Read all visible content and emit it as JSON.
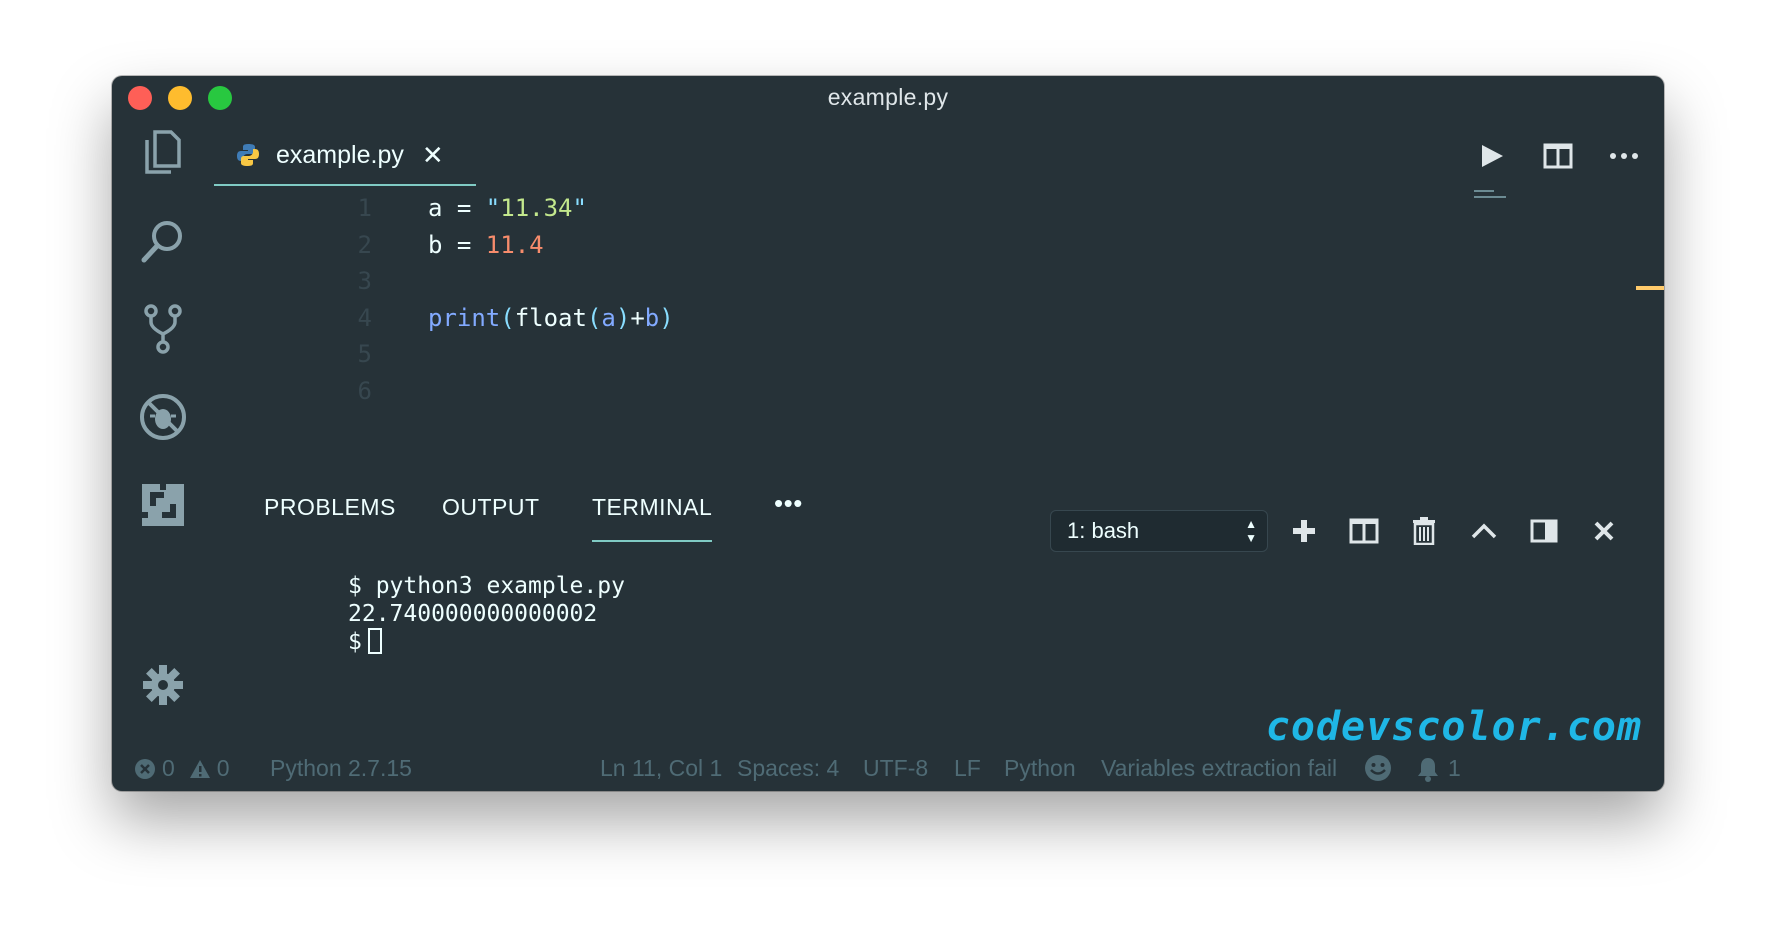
{
  "window": {
    "title": "example.py"
  },
  "tab": {
    "label": "example.py",
    "close": "✕"
  },
  "code_lines": [
    {
      "num": "1",
      "segments": [
        {
          "t": "a = ",
          "c": "plain"
        },
        {
          "t": "\"",
          "c": "str-q"
        },
        {
          "t": "11.34",
          "c": "str"
        },
        {
          "t": "\"",
          "c": "str-q"
        }
      ]
    },
    {
      "num": "2",
      "segments": [
        {
          "t": "b = ",
          "c": "plain"
        },
        {
          "t": "11.4",
          "c": "num"
        }
      ]
    },
    {
      "num": "3",
      "segments": []
    },
    {
      "num": "4",
      "segments": [
        {
          "t": "print",
          "c": "fn"
        },
        {
          "t": "(",
          "c": "punc"
        },
        {
          "t": "float",
          "c": "plain"
        },
        {
          "t": "(",
          "c": "punc"
        },
        {
          "t": "a",
          "c": "fn"
        },
        {
          "t": ")",
          "c": "punc"
        },
        {
          "t": "+",
          "c": "plain"
        },
        {
          "t": "b",
          "c": "fn"
        },
        {
          "t": ")",
          "c": "punc"
        }
      ]
    },
    {
      "num": "5",
      "segments": []
    },
    {
      "num": "6",
      "segments": []
    }
  ],
  "panel": {
    "tabs": [
      "PROBLEMS",
      "OUTPUT",
      "TERMINAL"
    ],
    "active_tab": "TERMINAL",
    "more": "•••",
    "terminal_select": "1: bash"
  },
  "terminal": {
    "lines": [
      "$ python3 example.py",
      "22.740000000000002"
    ],
    "prompt": "$"
  },
  "watermark": "codevscolor.com",
  "statusbar": {
    "errors": "0",
    "warnings": "0",
    "interpreter": "Python 2.7.15",
    "position": "Ln 11, Col 1",
    "spaces": "Spaces: 4",
    "encoding": "UTF-8",
    "eol": "LF",
    "language": "Python",
    "message": "Variables extraction fail",
    "notifications": "1"
  },
  "colors": {
    "background": "#263238",
    "accent": "#80cbc4",
    "string": "#c3e88d",
    "number": "#f78c6c",
    "function": "#82aaff",
    "watermark": "#1fb7e6"
  },
  "icons": {
    "activity": [
      "files-icon",
      "search-icon",
      "source-control-icon",
      "debug-icon",
      "extensions-icon",
      "settings-gear-icon"
    ],
    "editor_actions": [
      "run-icon",
      "split-editor-icon",
      "more-actions-icon"
    ],
    "panel_actions": [
      "plus-icon",
      "split-terminal-icon",
      "trash-icon",
      "chevron-up-icon",
      "toggle-panel-icon",
      "close-icon"
    ]
  }
}
